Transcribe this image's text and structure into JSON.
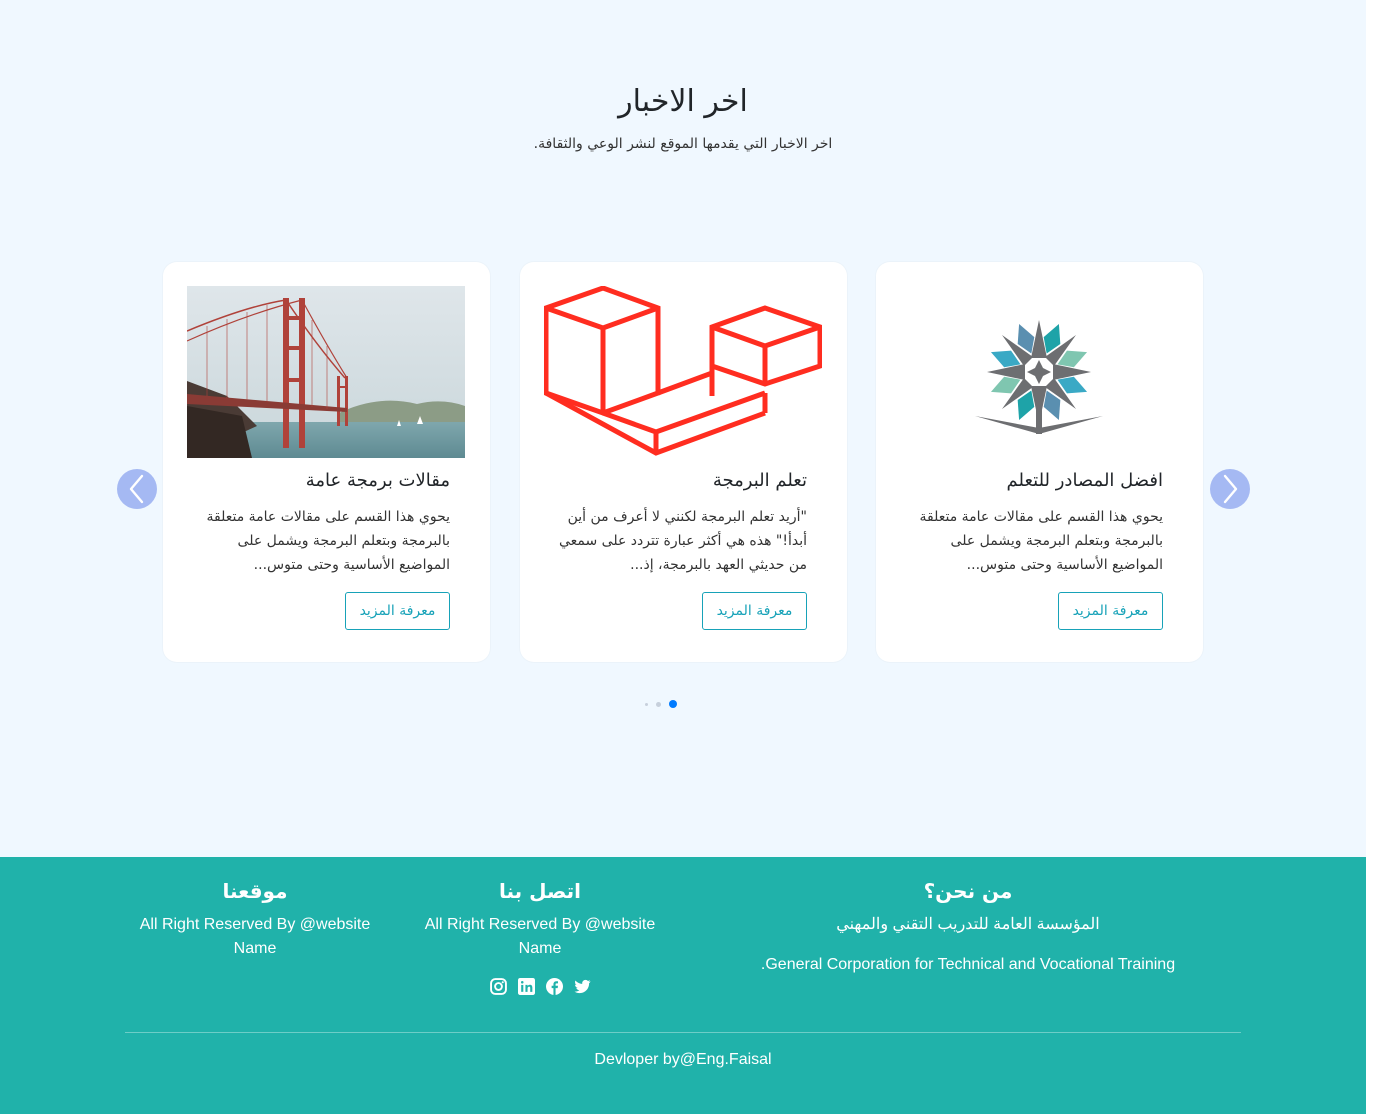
{
  "news": {
    "title": "اخر الاخبار",
    "subtitle": "اخر الاخبار التي يقدمها الموقع لنشر الوعي والثقافة."
  },
  "cards": [
    {
      "title": "افضل المصادر للتعلم",
      "text": "يحوي هذا القسم على مقالات عامة متعلقة بالبرمجة وبتعلم البرمجة ويشمل على المواضيع الأساسية وحتى متوس...",
      "button": "معرفة المزيد",
      "image": "tvtc-logo"
    },
    {
      "title": "تعلم البرمجة",
      "text": "\"أريد تعلم البرمجة لكنني لا أعرف من أين أبدأ!\" هذه هي أكثر عبارة تتردد على سمعي من حديثي العهد بالبرمجة، إذ...",
      "button": "معرفة المزيد",
      "image": "laravel-logo"
    },
    {
      "title": "مقالات برمجة عامة",
      "text": "يحوي هذا القسم على مقالات عامة متعلقة بالبرمجة وبتعلم البرمجة ويشمل على المواضيع الأساسية وحتى متوس...",
      "button": "معرفة المزيد",
      "image": "golden-gate-bridge-photo"
    }
  ],
  "carousel": {
    "prev_icon": "chevron-left-icon",
    "next_icon": "chevron-right-icon",
    "active_dot": 0,
    "dot_count": 3
  },
  "footer": {
    "about": {
      "heading": "من نحن؟",
      "line1": "المؤسسة العامة للتدريب التقني والمهني",
      "line2": ".General Corporation for Technical and Vocational Training"
    },
    "contact": {
      "heading": "اتصل بنا",
      "line1": "All Right Reserved By @website",
      "line2": "Name",
      "socials": [
        "instagram-icon",
        "linkedin-icon",
        "facebook-icon",
        "twitter-icon"
      ]
    },
    "site": {
      "heading": "موقعنا",
      "line1": "All Right Reserved By @website",
      "line2": "Name"
    },
    "credit": "Devloper by@Eng.Faisal"
  },
  "colors": {
    "page_bg": "#f0f8ff",
    "footer_bg": "#20b2aa",
    "accent": "#17a2b8",
    "arrow": "#a5b9f3",
    "active_dot": "#007bff",
    "laravel": "#ff2d20"
  }
}
